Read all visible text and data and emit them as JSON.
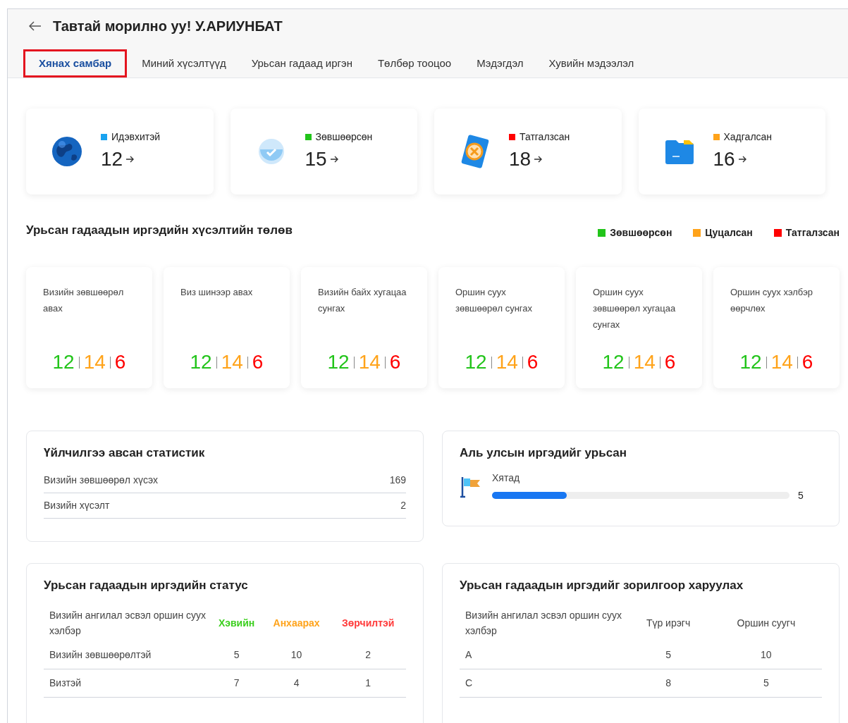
{
  "header": {
    "title": "Тавтай морилно уу! У.АРИУНБАТ"
  },
  "tabs": [
    {
      "label": "Хянах самбар",
      "selected": true
    },
    {
      "label": "Миний хүсэлтүүд",
      "selected": false
    },
    {
      "label": "Урьсан гадаад иргэн",
      "selected": false
    },
    {
      "label": "Төлбөр тооцоо",
      "selected": false
    },
    {
      "label": "Мэдэгдэл",
      "selected": false
    },
    {
      "label": "Хувийн мэдээлэл",
      "selected": false
    }
  ],
  "summary_cards": [
    {
      "kind": "globe",
      "label": "Идэвхитэй",
      "color": "#1aa3f0",
      "count": "12"
    },
    {
      "kind": "check",
      "label": "Зөвшөөрсөн",
      "color": "#22c41a",
      "count": "15"
    },
    {
      "kind": "cancel",
      "label": "Татгалзсан",
      "color": "#ff0000",
      "count": "18"
    },
    {
      "kind": "folder",
      "label": "Хадгалсан",
      "color": "#ffa31a",
      "count": "16"
    }
  ],
  "status_section": {
    "title": "Урьсан гадаадын иргэдийн хүсэлтийн төлөв",
    "legend": [
      {
        "label": "Зөвшөөрсөн",
        "color": "#22c41a"
      },
      {
        "label": "Цуцалсан",
        "color": "#ffa31a"
      },
      {
        "label": "Татгалзсан",
        "color": "#ff0000"
      }
    ],
    "cards": [
      {
        "title": "Визийн зөвшөөрөл авах",
        "values": [
          "12",
          "14",
          "6"
        ]
      },
      {
        "title": "Виз шинээр авах",
        "values": [
          "12",
          "14",
          "6"
        ]
      },
      {
        "title": "Визийн байх хугацаа сунгах",
        "values": [
          "12",
          "14",
          "6"
        ]
      },
      {
        "title": "Оршин суух зөвшөөрөл сунгах",
        "values": [
          "12",
          "14",
          "6"
        ]
      },
      {
        "title": "Оршин суух зөвшөөрөл хугацаа сунгах",
        "values": [
          "12",
          "14",
          "6"
        ]
      },
      {
        "title": "Оршин суух хэлбэр өөрчлөх",
        "values": [
          "12",
          "14",
          "6"
        ]
      }
    ]
  },
  "service_stats": {
    "title": "Үйлчилгээ авсан статистик",
    "rows": [
      {
        "label": "Визийн зөвшөөрөл хүсэх",
        "value": "169"
      },
      {
        "label": "Визийн хүсэлт",
        "value": "2"
      }
    ]
  },
  "countries": {
    "title": "Аль улсын иргэдийг урьсан",
    "items": [
      {
        "name": "Хятад",
        "level": 0.25,
        "value": "5"
      }
    ]
  },
  "status_table": {
    "title": "Урьсан гадаадын иргэдийн статус",
    "columns": [
      {
        "label": "Визийн ангилал эсвэл оршин суух хэлбэр"
      },
      {
        "label": "Хэвийн",
        "color": "#3ccf1f"
      },
      {
        "label": "Анхаарах",
        "color": "#ffa31a"
      },
      {
        "label": "Зөрчилтэй",
        "color": "#ff3b3b"
      }
    ],
    "rows": [
      [
        "Визийн зөвшөөрөлтэй",
        "5",
        "10",
        "2"
      ],
      [
        "Визтэй",
        "7",
        "4",
        "1"
      ]
    ]
  },
  "purpose_table": {
    "title": "Урьсан гадаадын иргэдийг зорилгоор харуулах",
    "columns": [
      {
        "label": "Визийн ангилал эсвэл оршин суух хэлбэр"
      },
      {
        "label": "Түр ирэгч"
      },
      {
        "label": "Оршин суугч"
      }
    ],
    "rows": [
      [
        "A",
        "5",
        "10"
      ],
      [
        "C",
        "8",
        "5"
      ]
    ]
  }
}
